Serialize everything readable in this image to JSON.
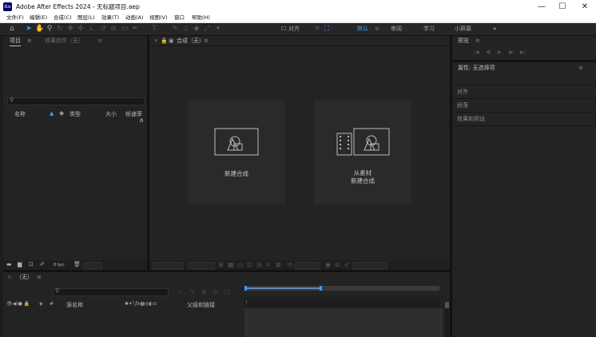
{
  "app": {
    "logo": "Ae",
    "title": "Adobe After Effects 2024 - 无标题项目.aep",
    "window_controls": [
      "minimize-icon",
      "maximize-icon",
      "close-icon"
    ]
  },
  "menu": [
    "文件(F)",
    "编辑(E)",
    "合成(C)",
    "图层(L)",
    "效果(T)",
    "动画(A)",
    "视图(V)",
    "窗口",
    "帮助(H)"
  ],
  "toolbar": {
    "snap_label": "对齐",
    "workspaces": [
      "默认",
      "审阅",
      "学习",
      "小屏幕"
    ],
    "active_workspace": "默认",
    "more": "»"
  },
  "project_panel": {
    "tab_project": "项目",
    "tab_effects": "效果控件（无）",
    "search_placeholder": "",
    "columns": {
      "name": "名称",
      "type": "类型",
      "size": "大小",
      "frame_rate": "帧速率"
    },
    "bpc": "8 bpc"
  },
  "comp_panel": {
    "tab": "合成（无）",
    "new_comp": "新建合成",
    "from_footage_line1": "从素材",
    "from_footage_line2": "新建合成"
  },
  "preview_panel": {
    "tab": "预览"
  },
  "properties_panel": {
    "tab": "属性: 无选择项",
    "sections": [
      "对齐",
      "段落",
      "效果和预设"
    ]
  },
  "timeline_panel": {
    "tab": "（无）",
    "columns": {
      "source_name": "源名称",
      "parent": "父级和链接"
    }
  },
  "colors": {
    "accent": "#3d9bff",
    "app_logo_bg": "#00005b",
    "panel_bg": "#232323"
  }
}
